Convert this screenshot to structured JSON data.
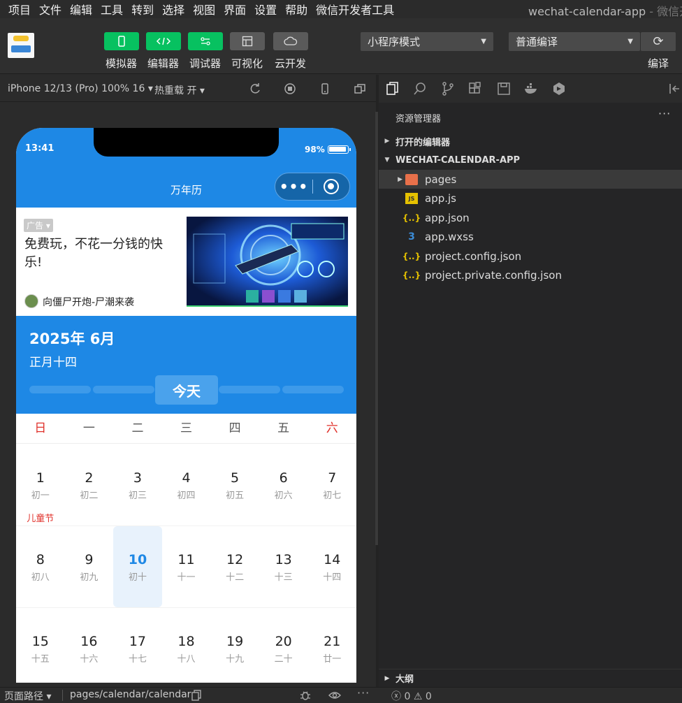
{
  "menubar": {
    "items": [
      "项目",
      "文件",
      "编辑",
      "工具",
      "转到",
      "选择",
      "视图",
      "界面",
      "设置",
      "帮助",
      "微信开发者工具"
    ],
    "window_title": "wechat-calendar-app",
    "window_suffix": " - 微信开发"
  },
  "toolbar": {
    "buttons": [
      {
        "label": "模拟器",
        "icon": "phone-icon"
      },
      {
        "label": "编辑器",
        "icon": "code-icon"
      },
      {
        "label": "调试器",
        "icon": "debug-icon"
      },
      {
        "label": "可视化",
        "icon": "layout-icon"
      },
      {
        "label": "云开发",
        "icon": "cloud-icon"
      }
    ],
    "mode_select": "小程序模式",
    "compile_select": "普通编译",
    "compile_label": "编译",
    "accent": "#07c160"
  },
  "simulator": {
    "device": "iPhone 12/13 (Pro) 100% 16 ▾",
    "hot_reload": "热重载 开 ▾"
  },
  "phone": {
    "time": "13:41",
    "battery": "98%",
    "nav_title": "万年历",
    "capsule_dots": "•••",
    "brand_color": "#1e88e5"
  },
  "ad": {
    "tag": "广告",
    "text": "免费玩，不花一分钱的快乐!",
    "source": "向僵尸开炮-尸潮来袭"
  },
  "calendar": {
    "year_month": "2025年  6月",
    "lunar_date": "正月十四",
    "today_button": "今天",
    "weekdays": [
      "日",
      "一",
      "二",
      "三",
      "四",
      "五",
      "六"
    ],
    "weeks": [
      [
        {
          "day": "1",
          "lunar": "初一",
          "festival": "儿童节"
        },
        {
          "day": "2",
          "lunar": "初二"
        },
        {
          "day": "3",
          "lunar": "初三"
        },
        {
          "day": "4",
          "lunar": "初四"
        },
        {
          "day": "5",
          "lunar": "初五"
        },
        {
          "day": "6",
          "lunar": "初六"
        },
        {
          "day": "7",
          "lunar": "初七"
        }
      ],
      [
        {
          "day": "8",
          "lunar": "初八"
        },
        {
          "day": "9",
          "lunar": "初九"
        },
        {
          "day": "10",
          "lunar": "初十",
          "today": true
        },
        {
          "day": "11",
          "lunar": "十一"
        },
        {
          "day": "12",
          "lunar": "十二"
        },
        {
          "day": "13",
          "lunar": "十三"
        },
        {
          "day": "14",
          "lunar": "十四"
        }
      ],
      [
        {
          "day": "15",
          "lunar": "十五"
        },
        {
          "day": "16",
          "lunar": "十六"
        },
        {
          "day": "17",
          "lunar": "十七"
        },
        {
          "day": "18",
          "lunar": "十八"
        },
        {
          "day": "19",
          "lunar": "十九"
        },
        {
          "day": "20",
          "lunar": "二十"
        },
        {
          "day": "21",
          "lunar": "廿一"
        }
      ]
    ]
  },
  "explorer": {
    "title": "资源管理器",
    "more": "···",
    "open_editors": "打开的编辑器",
    "project": "WECHAT-CALENDAR-APP",
    "files": [
      {
        "name": "pages",
        "type": "folder"
      },
      {
        "name": "app.js",
        "type": "js"
      },
      {
        "name": "app.json",
        "type": "json"
      },
      {
        "name": "app.wxss",
        "type": "css"
      },
      {
        "name": "project.config.json",
        "type": "json"
      },
      {
        "name": "project.private.config.json",
        "type": "json"
      }
    ],
    "outline": "大纲"
  },
  "statusbar": {
    "path_label": "页面路径 ▾",
    "path": "pages/calendar/calendar",
    "errors": "0",
    "warnings": "0"
  }
}
